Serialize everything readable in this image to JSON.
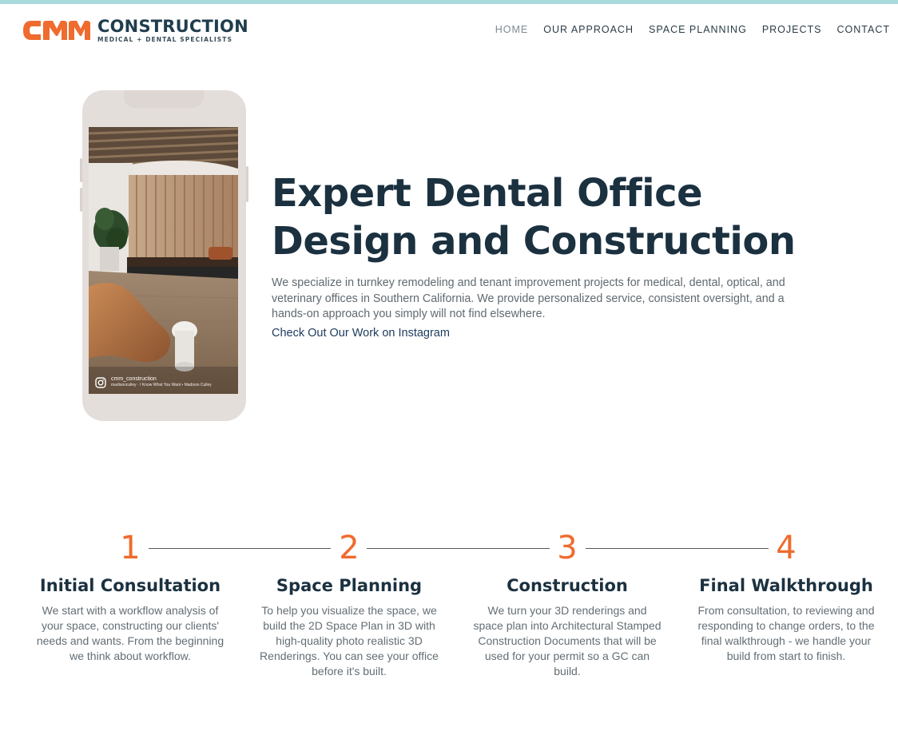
{
  "header": {
    "logo_word": "CONSTRUCTION",
    "logo_tag": "MEDICAL + DENTAL SPECIALISTS",
    "logo_mark": "CMM",
    "nav": [
      {
        "label": "HOME",
        "active": true
      },
      {
        "label": "OUR APPROACH",
        "active": false
      },
      {
        "label": "SPACE PLANNING",
        "active": false
      },
      {
        "label": "PROJECTS",
        "active": false
      },
      {
        "label": "CONTACT",
        "active": false
      }
    ]
  },
  "phone": {
    "ig_handle": "cmm_construction",
    "ig_caption": "madisonculley · I Know What You Want • Madison Culley",
    "icon": "instagram-icon"
  },
  "hero": {
    "title": "Expert Dental Office Design and Construction",
    "text": "We specialize in turnkey remodeling and tenant improvement projects for medical, dental, optical, and veterinary offices in Southern California. We provide personalized service, consistent oversight, and a hands-on approach you simply will not find elsewhere.",
    "link": "Check Out Our Work on Instagram"
  },
  "steps": [
    {
      "number": "1",
      "title": "Initial Consultation",
      "text": "We start with a workflow analysis of your space, constructing our clients' needs and wants. From the beginning we think about workflow."
    },
    {
      "number": "2",
      "title": "Space Planning",
      "text": "To help you visualize the space, we build the 2D Space Plan in 3D with high-quality photo realistic 3D Renderings. You can see your office before it's built."
    },
    {
      "number": "3",
      "title": "Construction",
      "text": "We turn your 3D renderings and space plan into Architectural Stamped Construction Documents that will be used for your permit so a GC can build."
    },
    {
      "number": "4",
      "title": "Final Walkthrough",
      "text": "From consultation, to reviewing and responding to change orders, to the final walkthrough - we handle your build from start to finish."
    }
  ],
  "colors": {
    "accent": "#ef6b2e",
    "navy": "#1b3140",
    "top_strip": "#a8dadc"
  }
}
